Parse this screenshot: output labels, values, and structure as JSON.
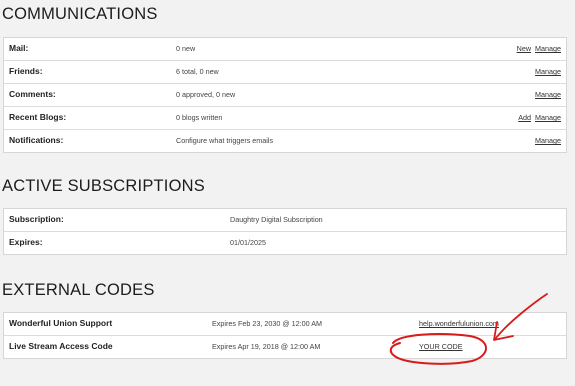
{
  "communications": {
    "title": "COMMUNICATIONS",
    "rows": [
      {
        "label": "Mail:",
        "value": "0 new",
        "links": [
          "New",
          "Manage"
        ]
      },
      {
        "label": "Friends:",
        "value": "6 total, 0 new",
        "links": [
          "Manage"
        ]
      },
      {
        "label": "Comments:",
        "value": "0 approved, 0 new",
        "links": [
          "Manage"
        ]
      },
      {
        "label": "Recent Blogs:",
        "value": "0 blogs written",
        "links": [
          "Add",
          "Manage"
        ]
      },
      {
        "label": "Notifications:",
        "value": "Configure what triggers emails",
        "links": [
          "Manage"
        ]
      }
    ]
  },
  "subscriptions": {
    "title": "ACTIVE SUBSCRIPTIONS",
    "rows": [
      {
        "label": "Subscription:",
        "value": "Daughtry Digital Subscription"
      },
      {
        "label": "Expires:",
        "value": "01/01/2025"
      }
    ]
  },
  "external_codes": {
    "title": "EXTERNAL CODES",
    "rows": [
      {
        "label": "Wonderful Union Support",
        "expires": "Expires Feb 23, 2030 @ 12:00 AM",
        "link": "help.wonderfulunion.com"
      },
      {
        "label": "Live Stream Access Code",
        "expires": "Expires Apr 19, 2018 @ 12:00 AM",
        "link": "YOUR CODE"
      }
    ]
  },
  "annotation_color": "#d81b1b"
}
